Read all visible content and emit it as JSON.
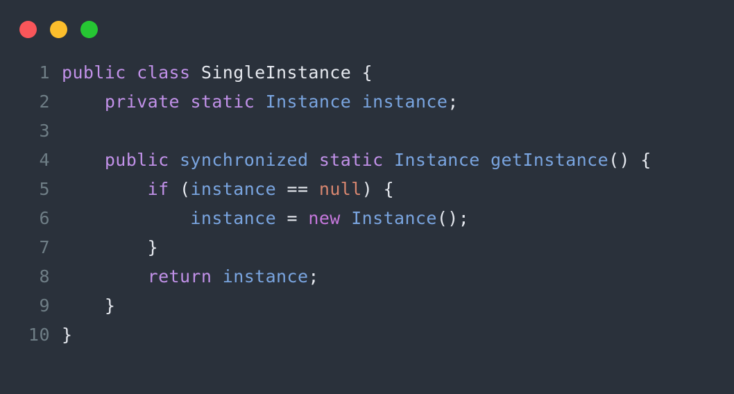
{
  "window": {
    "title": "",
    "background_color": "#2a313b",
    "controls": [
      {
        "name": "close",
        "color": "#f9565a"
      },
      {
        "name": "minimize",
        "color": "#fcbe2c"
      },
      {
        "name": "maximize",
        "color": "#26c633"
      }
    ]
  },
  "editor": {
    "language": "Java",
    "gutter_color": "#6f7e86",
    "colors": {
      "keyword": "#c191e8",
      "keyword_modifier": "#7aa5e0",
      "keyword_new": "#c678dd",
      "type": "#7aa5e0",
      "identifier": "#7aa5e0",
      "class_name": "#e6e9ef",
      "punctuation": "#e6e9ef",
      "literal_null": "#d98770"
    },
    "lines": [
      {
        "number": "1",
        "text": "public class SingleInstance {",
        "tokens": [
          {
            "t": "public",
            "c": "kw"
          },
          {
            "t": " ",
            "c": "plain"
          },
          {
            "t": "class",
            "c": "kw"
          },
          {
            "t": " ",
            "c": "plain"
          },
          {
            "t": "SingleInstance",
            "c": "cls"
          },
          {
            "t": " ",
            "c": "plain"
          },
          {
            "t": "{",
            "c": "punct"
          }
        ]
      },
      {
        "number": "2",
        "text": "    private static Instance instance;",
        "tokens": [
          {
            "t": "    ",
            "c": "plain"
          },
          {
            "t": "private",
            "c": "kw"
          },
          {
            "t": " ",
            "c": "plain"
          },
          {
            "t": "static",
            "c": "kw"
          },
          {
            "t": " ",
            "c": "plain"
          },
          {
            "t": "Instance",
            "c": "type"
          },
          {
            "t": " ",
            "c": "plain"
          },
          {
            "t": "instance",
            "c": "ident"
          },
          {
            "t": ";",
            "c": "punct"
          }
        ]
      },
      {
        "number": "3",
        "text": "",
        "tokens": []
      },
      {
        "number": "4",
        "text": "    public synchronized static Instance getInstance() {",
        "tokens": [
          {
            "t": "    ",
            "c": "plain"
          },
          {
            "t": "public",
            "c": "kw"
          },
          {
            "t": " ",
            "c": "plain"
          },
          {
            "t": "synchronized",
            "c": "kw2"
          },
          {
            "t": " ",
            "c": "plain"
          },
          {
            "t": "static",
            "c": "kw"
          },
          {
            "t": " ",
            "c": "plain"
          },
          {
            "t": "Instance",
            "c": "type"
          },
          {
            "t": " ",
            "c": "plain"
          },
          {
            "t": "getInstance",
            "c": "type"
          },
          {
            "t": "() {",
            "c": "punct"
          }
        ]
      },
      {
        "number": "5",
        "text": "        if (instance == null) {",
        "tokens": [
          {
            "t": "        ",
            "c": "plain"
          },
          {
            "t": "if",
            "c": "kw"
          },
          {
            "t": " (",
            "c": "punct"
          },
          {
            "t": "instance",
            "c": "ident"
          },
          {
            "t": " == ",
            "c": "punct"
          },
          {
            "t": "null",
            "c": "nul"
          },
          {
            "t": ") {",
            "c": "punct"
          }
        ]
      },
      {
        "number": "6",
        "text": "            instance = new Instance();",
        "tokens": [
          {
            "t": "            ",
            "c": "plain"
          },
          {
            "t": "instance",
            "c": "ident"
          },
          {
            "t": " = ",
            "c": "punct"
          },
          {
            "t": "new",
            "c": "kwnew"
          },
          {
            "t": " ",
            "c": "plain"
          },
          {
            "t": "Instance",
            "c": "type"
          },
          {
            "t": "();",
            "c": "punct"
          }
        ]
      },
      {
        "number": "7",
        "text": "        }",
        "tokens": [
          {
            "t": "        ",
            "c": "plain"
          },
          {
            "t": "}",
            "c": "punct"
          }
        ]
      },
      {
        "number": "8",
        "text": "        return instance;",
        "tokens": [
          {
            "t": "        ",
            "c": "plain"
          },
          {
            "t": "return",
            "c": "kw"
          },
          {
            "t": " ",
            "c": "plain"
          },
          {
            "t": "instance",
            "c": "ident"
          },
          {
            "t": ";",
            "c": "punct"
          }
        ]
      },
      {
        "number": "9",
        "text": "    }",
        "tokens": [
          {
            "t": "    ",
            "c": "plain"
          },
          {
            "t": "}",
            "c": "punct"
          }
        ]
      },
      {
        "number": "10",
        "text": "}",
        "tokens": [
          {
            "t": "}",
            "c": "punct"
          }
        ]
      }
    ]
  }
}
